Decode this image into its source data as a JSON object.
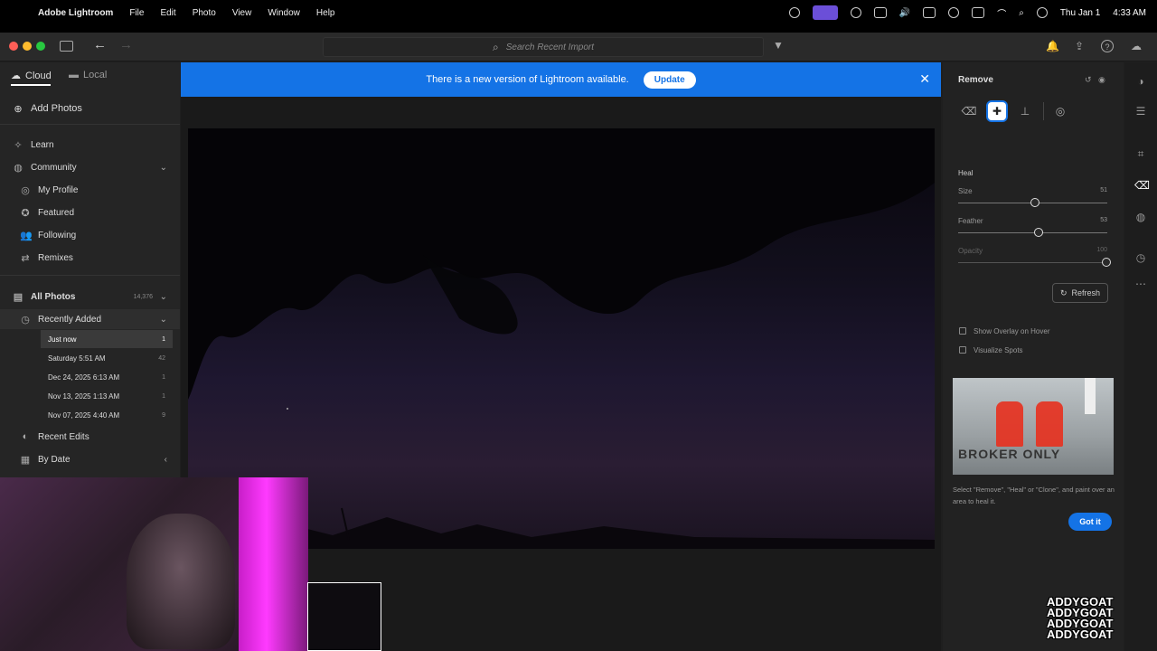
{
  "menubar": {
    "app_name": "Adobe Lightroom",
    "menus": [
      "File",
      "Edit",
      "Photo",
      "View",
      "Window",
      "Help"
    ],
    "date": "Thu Jan 1",
    "time": "4:33 AM"
  },
  "toolbar": {
    "search_placeholder": "Search Recent Import"
  },
  "left_panel": {
    "tabs": [
      "Cloud",
      "Local"
    ],
    "add_photos": "Add Photos",
    "learn": "Learn",
    "community": "Community",
    "community_items": [
      "My Profile",
      "Featured",
      "Following",
      "Remixes"
    ],
    "all_photos": "All Photos",
    "all_photos_count": "14,376",
    "recently_added": "Recently Added",
    "recent_items": [
      {
        "label": "Just now",
        "count": "1"
      },
      {
        "label": "Saturday  5:51 AM",
        "count": "42"
      },
      {
        "label": "Dec 24, 2025 6:13 AM",
        "count": "1"
      },
      {
        "label": "Nov 13, 2025 1:13 AM",
        "count": "1"
      },
      {
        "label": "Nov 07, 2025 4:40 AM",
        "count": "9"
      }
    ],
    "recent_edits": "Recent Edits",
    "by_date": "By Date"
  },
  "banner": {
    "message": "There is a new version of Lightroom available.",
    "update_label": "Update"
  },
  "right_panel": {
    "title": "Remove",
    "mode": "Heal",
    "size_label": "Size",
    "size_value": "51",
    "feather_label": "Feather",
    "feather_value": "53",
    "opacity_label": "Opacity",
    "opacity_value": "100",
    "refresh_label": "Refresh",
    "show_overlay": "Show Overlay on Hover",
    "visualize_spots": "Visualize Spots",
    "tip_image_text": "BROKER ONLY",
    "tip_text": "Select \"Remove\", \"Heal\" or \"Clone\", and paint over an area to heal it.",
    "got_it": "Got it"
  },
  "watermark": {
    "lines": [
      "ADDYGOAT",
      "ADDYGOAT",
      "ADDYGOAT",
      "ADDYGOAT"
    ]
  },
  "colors": {
    "accent": "#1473e6",
    "panel": "#252525",
    "selected_item": "#3a3a3a"
  }
}
